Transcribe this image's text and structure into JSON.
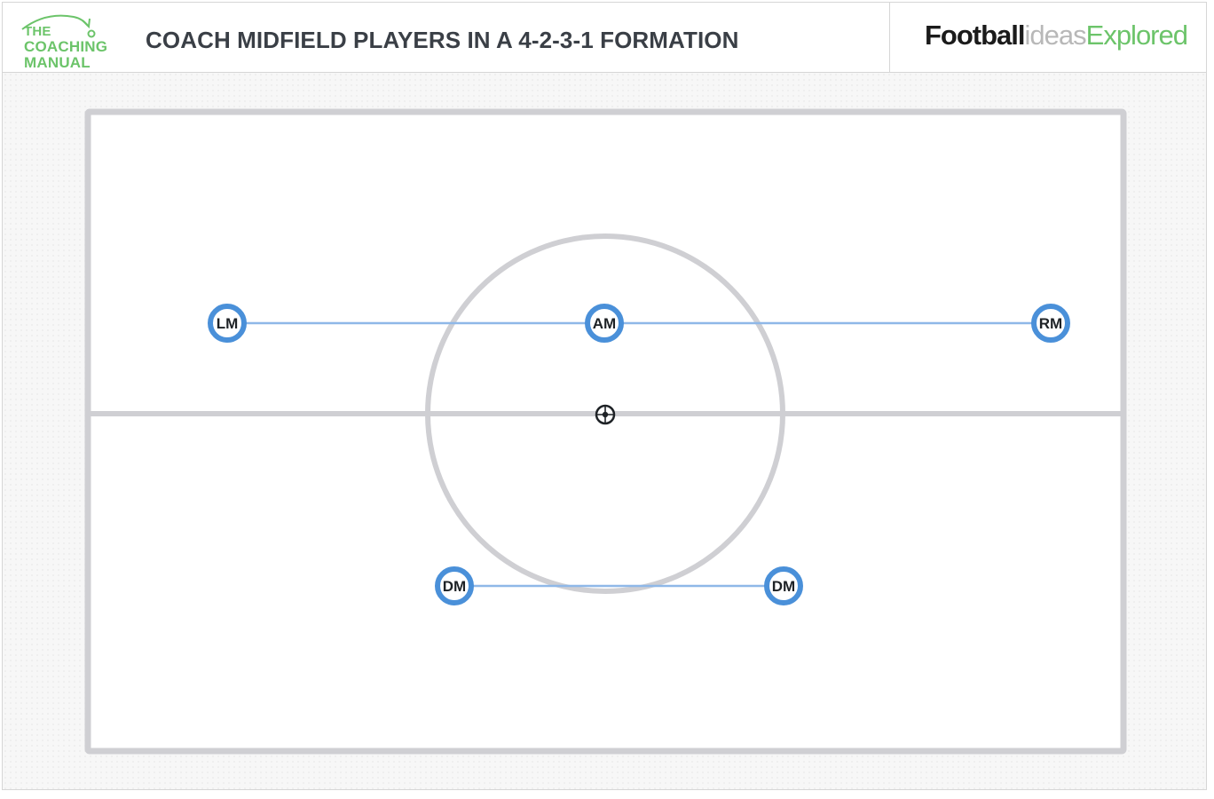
{
  "header": {
    "logo_lines": [
      "THE",
      "COACHING",
      "MANUAL"
    ],
    "title": "COACH MIDFIELD PLAYERS IN A 4-2-3-1 FORMATION",
    "brand": {
      "part1": "Football",
      "part2": "ideas",
      "part3": "Explored"
    }
  },
  "colors": {
    "brand_green": "#6cc46a",
    "player_ring": "#4a90d9",
    "link_line": "#8fb8e8",
    "pitch_lines": "#cfcfd3",
    "title_text": "#3a3f46"
  },
  "icons": {
    "ball": "football-icon",
    "logo_arrow": "curved-arrow-icon"
  },
  "players": [
    {
      "id": "lm",
      "label": "LM"
    },
    {
      "id": "am",
      "label": "AM"
    },
    {
      "id": "rm",
      "label": "RM"
    },
    {
      "id": "dm-left",
      "label": "DM"
    },
    {
      "id": "dm-right",
      "label": "DM"
    }
  ]
}
